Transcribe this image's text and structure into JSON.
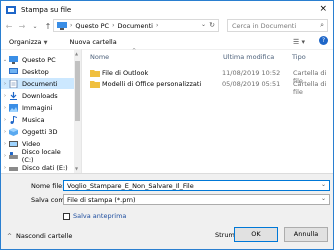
{
  "window": {
    "title": "Stampa su file",
    "close_icon": "×"
  },
  "nav": {
    "back": "←",
    "forward": "→",
    "history": "⌄",
    "up": "↑",
    "breadcrumbs": [
      "Questo PC",
      "Documenti"
    ],
    "search_placeholder": "Cerca in Documenti"
  },
  "toolbar": {
    "organize": "Organizza",
    "new_folder": "Nuova cartella"
  },
  "sidebar": {
    "items": [
      {
        "label": "Questo PC",
        "icon": "pc-icon",
        "expander": "⌄"
      },
      {
        "label": "Desktop",
        "icon": "desktop-icon",
        "expander": ""
      },
      {
        "label": "Documenti",
        "icon": "documents-icon",
        "expander": "›",
        "selected": true
      },
      {
        "label": "Downloads",
        "icon": "downloads-icon",
        "expander": "›"
      },
      {
        "label": "Immagini",
        "icon": "images-icon",
        "expander": "›"
      },
      {
        "label": "Musica",
        "icon": "music-icon",
        "expander": "›"
      },
      {
        "label": "Oggetti 3D",
        "icon": "3d-objects-icon",
        "expander": "›"
      },
      {
        "label": "Video",
        "icon": "video-icon",
        "expander": "›"
      },
      {
        "label": "Disco locale (C:)",
        "icon": "drive-icon",
        "expander": "›"
      },
      {
        "label": "Disco dati (E:)",
        "icon": "drive-icon",
        "expander": "›"
      },
      {
        "label": "Disco ...",
        "icon": "drive-icon",
        "expander": "›"
      }
    ]
  },
  "file_list": {
    "columns": {
      "name": "Nome",
      "modified": "Ultima modifica",
      "type": "Tipo"
    },
    "rows": [
      {
        "name": "File di Outlook",
        "modified": "11/08/2019 10:52",
        "type": "Cartella di file"
      },
      {
        "name": "Modelli di Office personalizzati",
        "modified": "05/08/2019 05:51",
        "type": "Cartella di file"
      }
    ]
  },
  "form": {
    "filename_label": "Nome file:",
    "filename_value": "Voglio_Stampare_E_Non_Salvare_Il_File",
    "save_as_label": "Salva come:",
    "save_as_value": "File di stampa (*.prn)",
    "checkbox_label": "Salva anteprima"
  },
  "footer": {
    "hide_folders": "Nascondi cartelle",
    "tools": "Strumenti",
    "ok": "OK",
    "cancel": "Annulla"
  },
  "colors": {
    "accent": "#0078d7",
    "folder": "#f0c040",
    "selection": "#cce8ff"
  }
}
